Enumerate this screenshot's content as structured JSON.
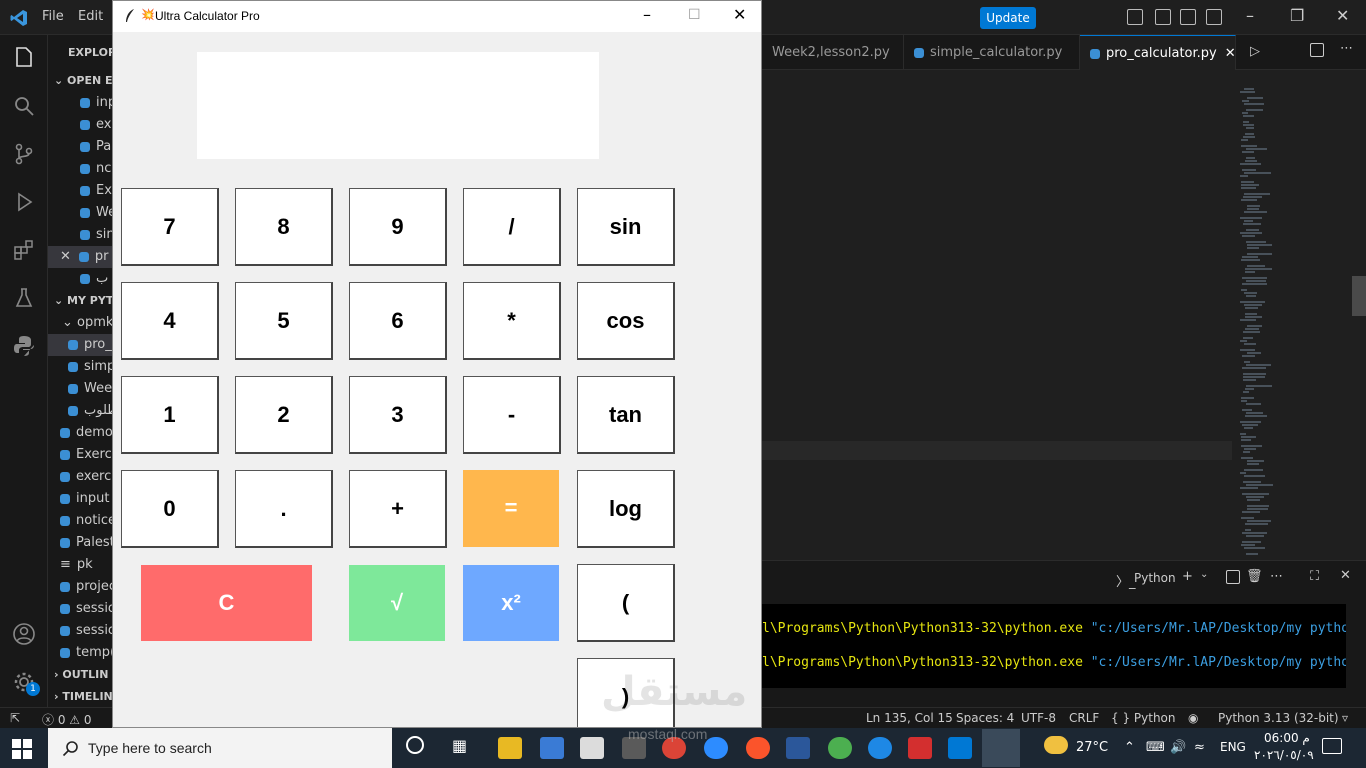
{
  "titlebar": {
    "menu": [
      "File",
      "Edit"
    ],
    "update_label": "Update"
  },
  "sidebar": {
    "explorer_label": "EXPLORE",
    "open_editors_label": "OPEN ED",
    "open_editors": [
      "inp",
      "ex",
      "Pa",
      "nc",
      "Ex",
      "We",
      "sin",
      "pr",
      "ب"
    ],
    "folder_label": "MY PYTH",
    "subfolder_label": "opmk",
    "subfolder_files": [
      "pro_",
      "simp",
      "Wee",
      "طلوب"
    ],
    "files": [
      "demo",
      "Exerci",
      "exerci",
      "input",
      "notice",
      "Palest",
      "pk",
      "projec",
      "sessio",
      "sessio",
      "temp("
    ],
    "outline_label": "OUTLIN",
    "timeline_label": "TIMELIN",
    "badge": "1"
  },
  "editor": {
    "tabs": [
      "Week2,lesson2.py",
      "simple_calculator.py",
      "pro_calculator.py"
    ]
  },
  "panel": {
    "terminal_label": "Python",
    "lines": [
      {
        "path": "l\\Programs\\Python\\Python313-32\\python.exe",
        "arg": "\"c:/Users/Mr.lAP/Desktop/my python"
      },
      {
        "path": "l\\Programs\\Python\\Python313-32\\python.exe",
        "arg": "\"c:/Users/Mr.lAP/Desktop/my python"
      }
    ]
  },
  "statusbar": {
    "problems": "ⓧ 0 ⚠ 0",
    "position": "Ln 135, Col 15",
    "spaces": "Spaces: 4",
    "encoding": "UTF-8",
    "eol": "CRLF",
    "language": "{ }  Python",
    "interpreter": "Python 3.13 (32-bit)"
  },
  "calculator": {
    "title": "Ultra Calculator Pro",
    "display_value": "",
    "buttons": {
      "b7": "7",
      "b8": "8",
      "b9": "9",
      "bdiv": "/",
      "bsin": "sin",
      "b4": "4",
      "b5": "5",
      "b6": "6",
      "bmul": "*",
      "bcos": "cos",
      "b1": "1",
      "b2": "2",
      "b3": "3",
      "bsub": "-",
      "btan": "tan",
      "b0": "0",
      "bdot": ".",
      "badd": "+",
      "beq": "=",
      "blog": "log",
      "bclear": "C",
      "bsqrt": "√",
      "bsq": "x²",
      "blparen": "(",
      "brparen": ")"
    },
    "colors": {
      "equals": "#ffb74d",
      "clear": "#ff6b6b",
      "sqrt": "#7ee89a",
      "square": "#6ea8ff"
    }
  },
  "taskbar": {
    "search_placeholder": "Type here to search",
    "weather": "27°C",
    "language": "ENG",
    "time": "06:00 م",
    "date": "٢٠٢٦/٠٥/٠٩"
  },
  "watermark": {
    "text": "مستقل",
    "sub": "mostaql.com"
  }
}
